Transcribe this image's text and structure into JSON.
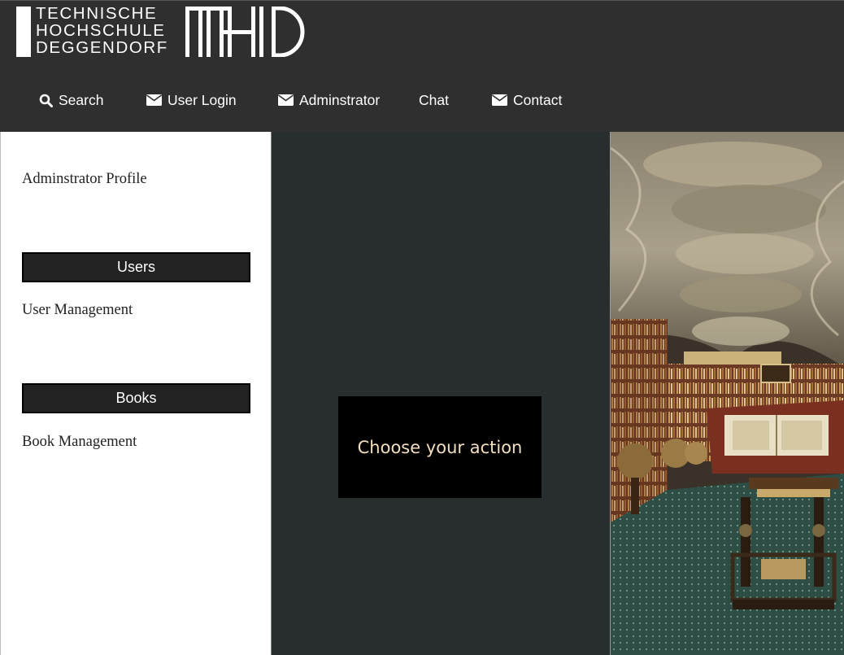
{
  "logo": {
    "line1": "TECHNISCHE",
    "line2": "HOCHSCHULE",
    "line3": "DEGGENDORF",
    "mark": "THD"
  },
  "nav": {
    "items": [
      {
        "label": "Search",
        "icon": "search-icon"
      },
      {
        "label": "User Login",
        "icon": "envelope-icon"
      },
      {
        "label": "Adminstrator",
        "icon": "envelope-icon"
      },
      {
        "label": "Chat",
        "icon": ""
      },
      {
        "label": "Contact",
        "icon": "envelope-icon"
      }
    ]
  },
  "sidebar": {
    "profile_link": "Adminstrator Profile",
    "sections": [
      {
        "header": "Users",
        "link": "User Management"
      },
      {
        "header": "Books",
        "link": "Book Management"
      }
    ]
  },
  "main": {
    "action_prompt": "Choose your action"
  },
  "colors": {
    "header_bg": "#2f2f2f",
    "main_bg": "#282d2e",
    "action_text": "#f3dfbf",
    "section_header_bg": "#222222"
  }
}
